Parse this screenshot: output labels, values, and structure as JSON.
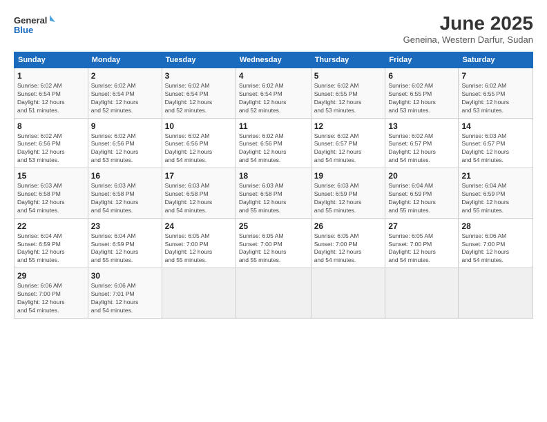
{
  "header": {
    "logo_line1": "General",
    "logo_line2": "Blue",
    "title": "June 2025",
    "location": "Geneina, Western Darfur, Sudan"
  },
  "weekdays": [
    "Sunday",
    "Monday",
    "Tuesday",
    "Wednesday",
    "Thursday",
    "Friday",
    "Saturday"
  ],
  "weeks": [
    [
      {
        "day": "1",
        "info": "Sunrise: 6:02 AM\nSunset: 6:54 PM\nDaylight: 12 hours\nand 51 minutes."
      },
      {
        "day": "2",
        "info": "Sunrise: 6:02 AM\nSunset: 6:54 PM\nDaylight: 12 hours\nand 52 minutes."
      },
      {
        "day": "3",
        "info": "Sunrise: 6:02 AM\nSunset: 6:54 PM\nDaylight: 12 hours\nand 52 minutes."
      },
      {
        "day": "4",
        "info": "Sunrise: 6:02 AM\nSunset: 6:54 PM\nDaylight: 12 hours\nand 52 minutes."
      },
      {
        "day": "5",
        "info": "Sunrise: 6:02 AM\nSunset: 6:55 PM\nDaylight: 12 hours\nand 53 minutes."
      },
      {
        "day": "6",
        "info": "Sunrise: 6:02 AM\nSunset: 6:55 PM\nDaylight: 12 hours\nand 53 minutes."
      },
      {
        "day": "7",
        "info": "Sunrise: 6:02 AM\nSunset: 6:55 PM\nDaylight: 12 hours\nand 53 minutes."
      }
    ],
    [
      {
        "day": "8",
        "info": "Sunrise: 6:02 AM\nSunset: 6:56 PM\nDaylight: 12 hours\nand 53 minutes."
      },
      {
        "day": "9",
        "info": "Sunrise: 6:02 AM\nSunset: 6:56 PM\nDaylight: 12 hours\nand 53 minutes."
      },
      {
        "day": "10",
        "info": "Sunrise: 6:02 AM\nSunset: 6:56 PM\nDaylight: 12 hours\nand 54 minutes."
      },
      {
        "day": "11",
        "info": "Sunrise: 6:02 AM\nSunset: 6:56 PM\nDaylight: 12 hours\nand 54 minutes."
      },
      {
        "day": "12",
        "info": "Sunrise: 6:02 AM\nSunset: 6:57 PM\nDaylight: 12 hours\nand 54 minutes."
      },
      {
        "day": "13",
        "info": "Sunrise: 6:02 AM\nSunset: 6:57 PM\nDaylight: 12 hours\nand 54 minutes."
      },
      {
        "day": "14",
        "info": "Sunrise: 6:03 AM\nSunset: 6:57 PM\nDaylight: 12 hours\nand 54 minutes."
      }
    ],
    [
      {
        "day": "15",
        "info": "Sunrise: 6:03 AM\nSunset: 6:58 PM\nDaylight: 12 hours\nand 54 minutes."
      },
      {
        "day": "16",
        "info": "Sunrise: 6:03 AM\nSunset: 6:58 PM\nDaylight: 12 hours\nand 54 minutes."
      },
      {
        "day": "17",
        "info": "Sunrise: 6:03 AM\nSunset: 6:58 PM\nDaylight: 12 hours\nand 54 minutes."
      },
      {
        "day": "18",
        "info": "Sunrise: 6:03 AM\nSunset: 6:58 PM\nDaylight: 12 hours\nand 55 minutes."
      },
      {
        "day": "19",
        "info": "Sunrise: 6:03 AM\nSunset: 6:59 PM\nDaylight: 12 hours\nand 55 minutes."
      },
      {
        "day": "20",
        "info": "Sunrise: 6:04 AM\nSunset: 6:59 PM\nDaylight: 12 hours\nand 55 minutes."
      },
      {
        "day": "21",
        "info": "Sunrise: 6:04 AM\nSunset: 6:59 PM\nDaylight: 12 hours\nand 55 minutes."
      }
    ],
    [
      {
        "day": "22",
        "info": "Sunrise: 6:04 AM\nSunset: 6:59 PM\nDaylight: 12 hours\nand 55 minutes."
      },
      {
        "day": "23",
        "info": "Sunrise: 6:04 AM\nSunset: 6:59 PM\nDaylight: 12 hours\nand 55 minutes."
      },
      {
        "day": "24",
        "info": "Sunrise: 6:05 AM\nSunset: 7:00 PM\nDaylight: 12 hours\nand 55 minutes."
      },
      {
        "day": "25",
        "info": "Sunrise: 6:05 AM\nSunset: 7:00 PM\nDaylight: 12 hours\nand 55 minutes."
      },
      {
        "day": "26",
        "info": "Sunrise: 6:05 AM\nSunset: 7:00 PM\nDaylight: 12 hours\nand 54 minutes."
      },
      {
        "day": "27",
        "info": "Sunrise: 6:05 AM\nSunset: 7:00 PM\nDaylight: 12 hours\nand 54 minutes."
      },
      {
        "day": "28",
        "info": "Sunrise: 6:06 AM\nSunset: 7:00 PM\nDaylight: 12 hours\nand 54 minutes."
      }
    ],
    [
      {
        "day": "29",
        "info": "Sunrise: 6:06 AM\nSunset: 7:00 PM\nDaylight: 12 hours\nand 54 minutes."
      },
      {
        "day": "30",
        "info": "Sunrise: 6:06 AM\nSunset: 7:01 PM\nDaylight: 12 hours\nand 54 minutes."
      },
      {
        "day": "",
        "info": ""
      },
      {
        "day": "",
        "info": ""
      },
      {
        "day": "",
        "info": ""
      },
      {
        "day": "",
        "info": ""
      },
      {
        "day": "",
        "info": ""
      }
    ]
  ]
}
